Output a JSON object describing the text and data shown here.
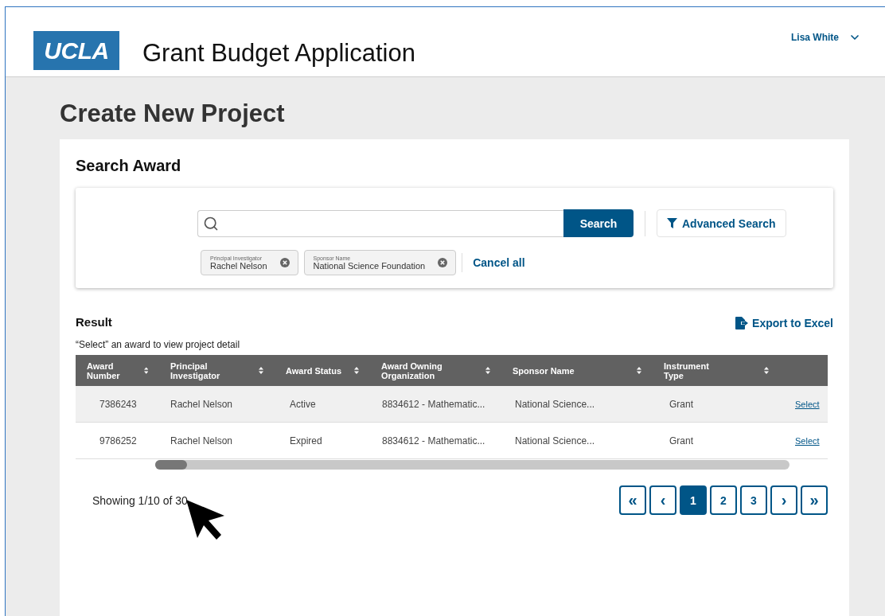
{
  "header": {
    "logo": "UCLA",
    "app_title": "Grant Budget Application",
    "user": "Lisa White"
  },
  "page_title": "Create New Project",
  "search_section": {
    "title": "Search Award",
    "search_button": "Search",
    "advanced_button": "Advanced Search",
    "filters": [
      {
        "label": "Principal Investigator",
        "value": "Rachel Nelson"
      },
      {
        "label": "Sponsor Name",
        "value": "National Science Foundation"
      }
    ],
    "cancel_all": "Cancel all"
  },
  "result": {
    "title": "Result",
    "export": "Export to Excel",
    "hint": "“Select” an award to view project detail",
    "columns": [
      {
        "label": "Award Number"
      },
      {
        "label": "Principal Investigator"
      },
      {
        "label": "Award Status"
      },
      {
        "label": "Award Owning Organization"
      },
      {
        "label": "Sponsor Name"
      },
      {
        "label": "Instrument Type"
      }
    ],
    "rows": [
      {
        "cells": [
          "7386243",
          "Rachel Nelson",
          "Active",
          "8834612  - Mathematic...",
          "National Science...",
          "Grant"
        ],
        "action": "Select",
        "highlighted": true
      },
      {
        "cells": [
          "9786252",
          "Rachel Nelson",
          "Expired",
          "8834612  - Mathematic...",
          "National Science...",
          "Grant"
        ],
        "action": "Select",
        "highlighted": false
      }
    ],
    "showing": "Showing 1/10 of 30",
    "pages": [
      {
        "kind": "first",
        "label": "«",
        "selected": false
      },
      {
        "kind": "prev",
        "label": "‹",
        "selected": false
      },
      {
        "kind": "page",
        "label": "1",
        "selected": true
      },
      {
        "kind": "page",
        "label": "2",
        "selected": false
      },
      {
        "kind": "page",
        "label": "3",
        "selected": false
      },
      {
        "kind": "next",
        "label": "›",
        "selected": false
      },
      {
        "kind": "last",
        "label": "»",
        "selected": false
      }
    ]
  }
}
